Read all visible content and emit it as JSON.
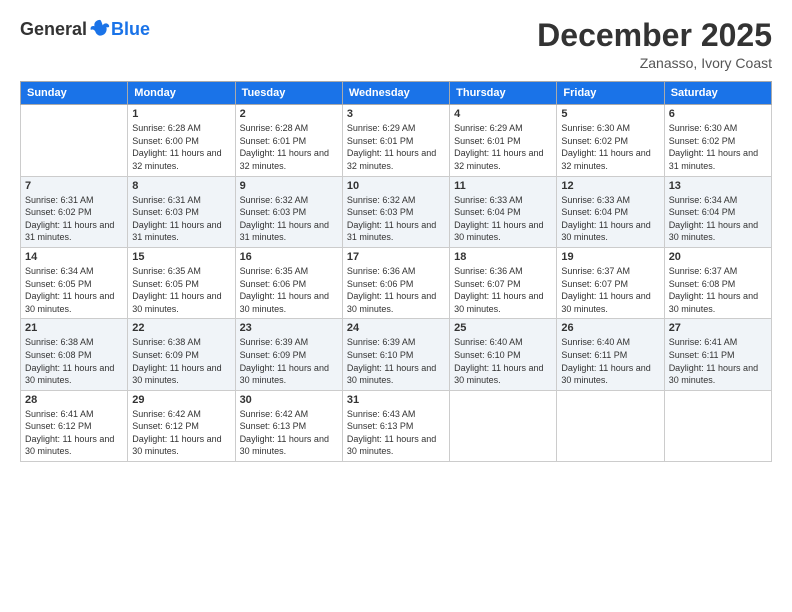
{
  "header": {
    "logo_general": "General",
    "logo_blue": "Blue",
    "title": "December 2025",
    "subtitle": "Zanasso, Ivory Coast"
  },
  "calendar": {
    "headers": [
      "Sunday",
      "Monday",
      "Tuesday",
      "Wednesday",
      "Thursday",
      "Friday",
      "Saturday"
    ],
    "rows": [
      [
        {
          "num": "",
          "sunrise": "",
          "sunset": "",
          "daylight": ""
        },
        {
          "num": "1",
          "sunrise": "Sunrise: 6:28 AM",
          "sunset": "Sunset: 6:00 PM",
          "daylight": "Daylight: 11 hours and 32 minutes."
        },
        {
          "num": "2",
          "sunrise": "Sunrise: 6:28 AM",
          "sunset": "Sunset: 6:01 PM",
          "daylight": "Daylight: 11 hours and 32 minutes."
        },
        {
          "num": "3",
          "sunrise": "Sunrise: 6:29 AM",
          "sunset": "Sunset: 6:01 PM",
          "daylight": "Daylight: 11 hours and 32 minutes."
        },
        {
          "num": "4",
          "sunrise": "Sunrise: 6:29 AM",
          "sunset": "Sunset: 6:01 PM",
          "daylight": "Daylight: 11 hours and 32 minutes."
        },
        {
          "num": "5",
          "sunrise": "Sunrise: 6:30 AM",
          "sunset": "Sunset: 6:02 PM",
          "daylight": "Daylight: 11 hours and 32 minutes."
        },
        {
          "num": "6",
          "sunrise": "Sunrise: 6:30 AM",
          "sunset": "Sunset: 6:02 PM",
          "daylight": "Daylight: 11 hours and 31 minutes."
        }
      ],
      [
        {
          "num": "7",
          "sunrise": "Sunrise: 6:31 AM",
          "sunset": "Sunset: 6:02 PM",
          "daylight": "Daylight: 11 hours and 31 minutes."
        },
        {
          "num": "8",
          "sunrise": "Sunrise: 6:31 AM",
          "sunset": "Sunset: 6:03 PM",
          "daylight": "Daylight: 11 hours and 31 minutes."
        },
        {
          "num": "9",
          "sunrise": "Sunrise: 6:32 AM",
          "sunset": "Sunset: 6:03 PM",
          "daylight": "Daylight: 11 hours and 31 minutes."
        },
        {
          "num": "10",
          "sunrise": "Sunrise: 6:32 AM",
          "sunset": "Sunset: 6:03 PM",
          "daylight": "Daylight: 11 hours and 31 minutes."
        },
        {
          "num": "11",
          "sunrise": "Sunrise: 6:33 AM",
          "sunset": "Sunset: 6:04 PM",
          "daylight": "Daylight: 11 hours and 30 minutes."
        },
        {
          "num": "12",
          "sunrise": "Sunrise: 6:33 AM",
          "sunset": "Sunset: 6:04 PM",
          "daylight": "Daylight: 11 hours and 30 minutes."
        },
        {
          "num": "13",
          "sunrise": "Sunrise: 6:34 AM",
          "sunset": "Sunset: 6:04 PM",
          "daylight": "Daylight: 11 hours and 30 minutes."
        }
      ],
      [
        {
          "num": "14",
          "sunrise": "Sunrise: 6:34 AM",
          "sunset": "Sunset: 6:05 PM",
          "daylight": "Daylight: 11 hours and 30 minutes."
        },
        {
          "num": "15",
          "sunrise": "Sunrise: 6:35 AM",
          "sunset": "Sunset: 6:05 PM",
          "daylight": "Daylight: 11 hours and 30 minutes."
        },
        {
          "num": "16",
          "sunrise": "Sunrise: 6:35 AM",
          "sunset": "Sunset: 6:06 PM",
          "daylight": "Daylight: 11 hours and 30 minutes."
        },
        {
          "num": "17",
          "sunrise": "Sunrise: 6:36 AM",
          "sunset": "Sunset: 6:06 PM",
          "daylight": "Daylight: 11 hours and 30 minutes."
        },
        {
          "num": "18",
          "sunrise": "Sunrise: 6:36 AM",
          "sunset": "Sunset: 6:07 PM",
          "daylight": "Daylight: 11 hours and 30 minutes."
        },
        {
          "num": "19",
          "sunrise": "Sunrise: 6:37 AM",
          "sunset": "Sunset: 6:07 PM",
          "daylight": "Daylight: 11 hours and 30 minutes."
        },
        {
          "num": "20",
          "sunrise": "Sunrise: 6:37 AM",
          "sunset": "Sunset: 6:08 PM",
          "daylight": "Daylight: 11 hours and 30 minutes."
        }
      ],
      [
        {
          "num": "21",
          "sunrise": "Sunrise: 6:38 AM",
          "sunset": "Sunset: 6:08 PM",
          "daylight": "Daylight: 11 hours and 30 minutes."
        },
        {
          "num": "22",
          "sunrise": "Sunrise: 6:38 AM",
          "sunset": "Sunset: 6:09 PM",
          "daylight": "Daylight: 11 hours and 30 minutes."
        },
        {
          "num": "23",
          "sunrise": "Sunrise: 6:39 AM",
          "sunset": "Sunset: 6:09 PM",
          "daylight": "Daylight: 11 hours and 30 minutes."
        },
        {
          "num": "24",
          "sunrise": "Sunrise: 6:39 AM",
          "sunset": "Sunset: 6:10 PM",
          "daylight": "Daylight: 11 hours and 30 minutes."
        },
        {
          "num": "25",
          "sunrise": "Sunrise: 6:40 AM",
          "sunset": "Sunset: 6:10 PM",
          "daylight": "Daylight: 11 hours and 30 minutes."
        },
        {
          "num": "26",
          "sunrise": "Sunrise: 6:40 AM",
          "sunset": "Sunset: 6:11 PM",
          "daylight": "Daylight: 11 hours and 30 minutes."
        },
        {
          "num": "27",
          "sunrise": "Sunrise: 6:41 AM",
          "sunset": "Sunset: 6:11 PM",
          "daylight": "Daylight: 11 hours and 30 minutes."
        }
      ],
      [
        {
          "num": "28",
          "sunrise": "Sunrise: 6:41 AM",
          "sunset": "Sunset: 6:12 PM",
          "daylight": "Daylight: 11 hours and 30 minutes."
        },
        {
          "num": "29",
          "sunrise": "Sunrise: 6:42 AM",
          "sunset": "Sunset: 6:12 PM",
          "daylight": "Daylight: 11 hours and 30 minutes."
        },
        {
          "num": "30",
          "sunrise": "Sunrise: 6:42 AM",
          "sunset": "Sunset: 6:13 PM",
          "daylight": "Daylight: 11 hours and 30 minutes."
        },
        {
          "num": "31",
          "sunrise": "Sunrise: 6:43 AM",
          "sunset": "Sunset: 6:13 PM",
          "daylight": "Daylight: 11 hours and 30 minutes."
        },
        {
          "num": "",
          "sunrise": "",
          "sunset": "",
          "daylight": ""
        },
        {
          "num": "",
          "sunrise": "",
          "sunset": "",
          "daylight": ""
        },
        {
          "num": "",
          "sunrise": "",
          "sunset": "",
          "daylight": ""
        }
      ]
    ]
  }
}
